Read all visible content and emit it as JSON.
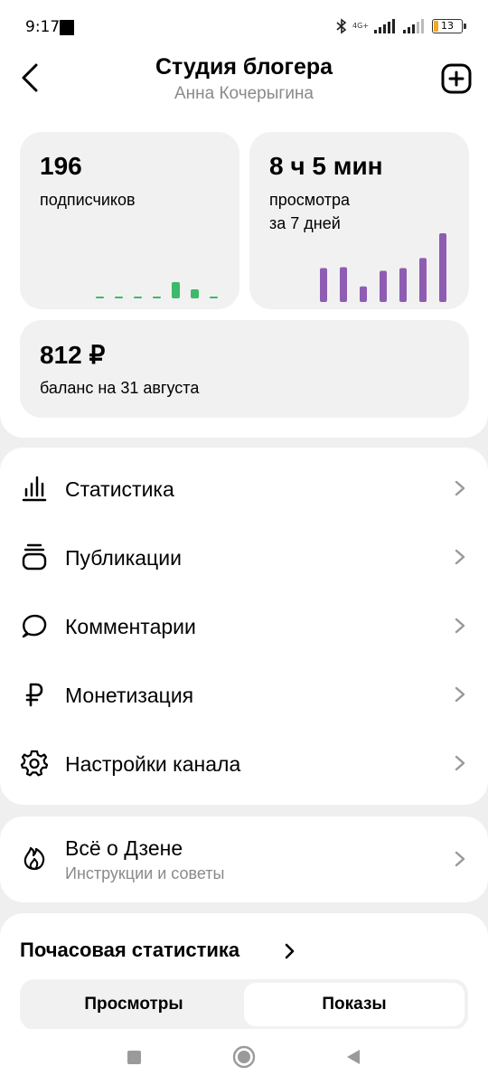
{
  "status_bar": {
    "time": "9:17",
    "network": "4G+",
    "battery": "13"
  },
  "header": {
    "title": "Студия блогера",
    "subtitle": "Анна Кочерыгина"
  },
  "stats": {
    "subscribers": {
      "value": "196",
      "label": "подписчиков",
      "chart_values": [
        0,
        0,
        0,
        0,
        4,
        2,
        0,
        0
      ],
      "color": "#3cb96a"
    },
    "views": {
      "value": "8 ч 5 мин",
      "label_line1": "просмотра",
      "label_line2": "за 7 дней",
      "chart_values": [
        37,
        38,
        17,
        34,
        37,
        48,
        75
      ],
      "color": "#8e5db3"
    },
    "balance": {
      "value": "812 ₽",
      "label": "баланс на 31 августа"
    }
  },
  "menu": [
    {
      "id": "stats",
      "label": "Статистика",
      "icon": "bar-chart-icon"
    },
    {
      "id": "publications",
      "label": "Публикации",
      "icon": "stack-icon"
    },
    {
      "id": "comments",
      "label": "Комментарии",
      "icon": "speech-bubble-icon"
    },
    {
      "id": "monetization",
      "label": "Монетизация",
      "icon": "ruble-icon"
    },
    {
      "id": "settings",
      "label": "Настройки канала",
      "icon": "gear-icon"
    }
  ],
  "zen": {
    "title": "Всё о Дзене",
    "subtitle": "Инструкции и советы",
    "icon": "flame-icon"
  },
  "hourly": {
    "title": "Почасовая статистика",
    "tabs": [
      "Просмотры",
      "Показы"
    ],
    "active_tab": 1
  }
}
